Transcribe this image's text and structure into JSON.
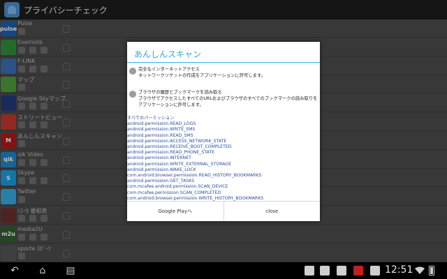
{
  "app": {
    "title": "プライバシーチェック"
  },
  "apps": [
    {
      "name": "Pulse",
      "icon": "pulse-icon",
      "label": "pulse",
      "color": "#1f5fae"
    },
    {
      "name": "Evernote",
      "icon": "evernote-icon",
      "label": "",
      "color": "#2f8f3a"
    },
    {
      "name": "F-LINK",
      "icon": "flink-icon",
      "label": "",
      "color": "#3b6fb5"
    },
    {
      "name": "マップ",
      "icon": "maps-icon",
      "label": "",
      "color": "#4f9b3c"
    },
    {
      "name": "Google Skyマップ",
      "icon": "skymap-icon",
      "label": "",
      "color": "#203a7a"
    },
    {
      "name": "ストリートビュー",
      "icon": "streetview-icon",
      "label": "",
      "color": "#c0392b"
    },
    {
      "name": "あんしんスキャン",
      "icon": "mcafee-icon",
      "label": "M",
      "color": "#b01919"
    },
    {
      "name": "qik Video",
      "icon": "qik-icon",
      "label": "qik",
      "color": "#1f86c9"
    },
    {
      "name": "Skype",
      "icon": "skype-icon",
      "label": "S",
      "color": "#1a9ee0"
    },
    {
      "name": "Twitter",
      "icon": "twitter-icon",
      "label": "",
      "color": "#39a9e0"
    },
    {
      "name": "ｼｴｰｶ 番組表",
      "icon": "tvguide-icon",
      "label": "",
      "color": "#6b2f2f"
    },
    {
      "name": "media2U",
      "icon": "media2u-icon",
      "label": "m2u",
      "color": "#2f5f2f"
    },
    {
      "name": "sporte ｽﾎﾟｰﾂ",
      "icon": "sports-icon",
      "label": "",
      "color": "#555555"
    }
  ],
  "dialog": {
    "title": "あんしんスキャン",
    "perm1_title": "完全なインターネットアクセス",
    "perm1_desc": "ネットワークソケットの作成をアプリケーションに許可します。",
    "perm2_title": "ブラウザの履歴とブックマークを読み取る",
    "perm2_desc": "ブラウザでアクセスしたすべてのURLおよびブラウザのすべてのブックマークの読み取りをアプリケーションに許可します。",
    "all_header": "すべてのパーミッション",
    "permissions": [
      "android.permission.READ_LOGS",
      "android.permission.WRITE_SMS",
      "android.permission.READ_SMS",
      "android.permission.ACCESS_NETWORK_STATE",
      "android.permission.RECEIVE_BOOT_COMPLETED",
      "android.permission.READ_PHONE_STATE",
      "android.permission.INTERNET",
      "android.permission.WRITE_EXTERNAL_STORAGE",
      "android.permission.WAKE_LOCK",
      "com.android.browser.permission.READ_HISTORY_BOOKMARKS",
      "android.permission.GET_TASKS",
      "com.mcafee.android.permission.SCAN_DEVICE",
      "com.mcafee.permission.SCAN_COMPLETED",
      "com.android.browser.permission.WRITE_HISTORY_BOOKMARKS"
    ],
    "btn_play": "Google Playへ",
    "btn_close": "close"
  },
  "statusbar": {
    "time": "12:51"
  }
}
